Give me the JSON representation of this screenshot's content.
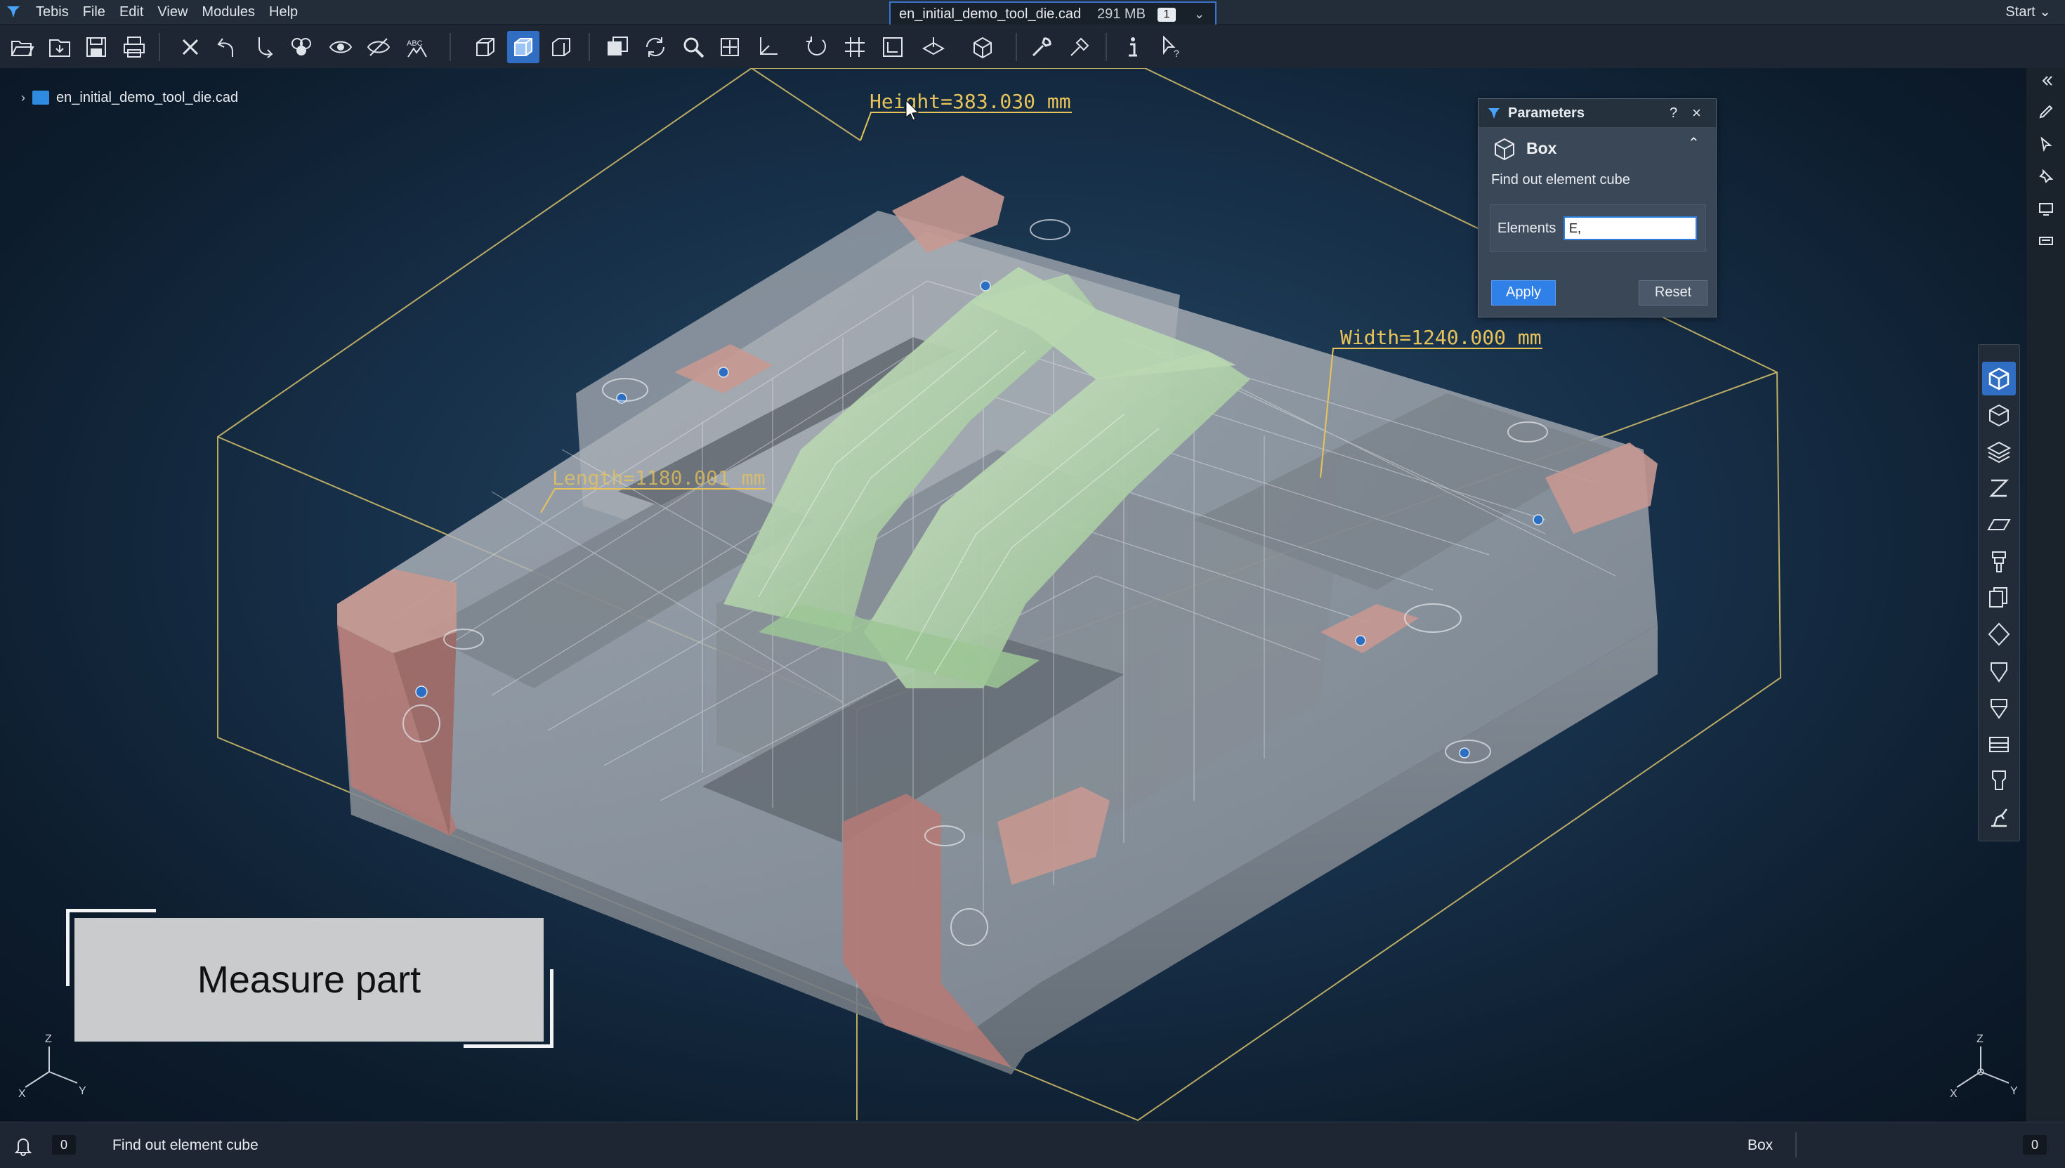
{
  "app": {
    "name": "Tebis",
    "menus": [
      "File",
      "Edit",
      "View",
      "Modules",
      "Help"
    ],
    "start_label": "Start"
  },
  "document_tab": {
    "filename": "en_initial_demo_tool_die.cad",
    "memory": "291 MB",
    "window_count": "1"
  },
  "toolbar": {
    "icons": [
      "open-icon",
      "import-icon",
      "save-icon",
      "print-icon",
      "delete-icon",
      "undo-icon",
      "redo-icon",
      "layers-icon",
      "show-icon",
      "hide-icon",
      "text-icon",
      "view-front-icon",
      "view-iso-icon",
      "view-side-icon",
      "window-icon",
      "refresh-icon",
      "zoom-icon",
      "pan-icon",
      "snap-icon",
      "rotate-icon",
      "grid-icon",
      "frame-icon",
      "plane-icon",
      "box-icon",
      "tools-icon",
      "analysis-icon",
      "info-icon",
      "help-cursor-icon"
    ],
    "active": "view-iso-icon"
  },
  "tree": {
    "root": "en_initial_demo_tool_die.cad"
  },
  "dimensions": {
    "height": "Height=383.030 mm",
    "width": "Width=1240.000 mm",
    "length": "Length=1180.001 mm"
  },
  "parameters_panel": {
    "title": "Parameters",
    "help": "?",
    "close": "×",
    "section_title": "Box",
    "description": "Find out element cube",
    "elements_label": "Elements",
    "elements_value": "E,",
    "apply_label": "Apply",
    "reset_label": "Reset"
  },
  "palette": {
    "icons": [
      "box-icon",
      "solid-icon",
      "layers-stack-icon",
      "z-level-icon",
      "surface-icon",
      "tool-holder-icon",
      "copy-icon",
      "diamond-icon",
      "cutter-icon",
      "cutter-alt-icon",
      "drawer-icon",
      "mill-icon",
      "robot-icon"
    ],
    "active": "box-icon"
  },
  "caption": {
    "text": "Measure part"
  },
  "axis_labels": {
    "z": "Z",
    "x": "X",
    "y": "Y"
  },
  "status": {
    "notification_count": "0",
    "message": "Find out element cube",
    "mode": "Box",
    "right_count": "0"
  },
  "colors": {
    "accent": "#2f6ec2",
    "dimension": "#e7c35a",
    "part_gray": "#9aa0a6",
    "part_green": "#a9cda0",
    "part_red": "#b47a76"
  }
}
